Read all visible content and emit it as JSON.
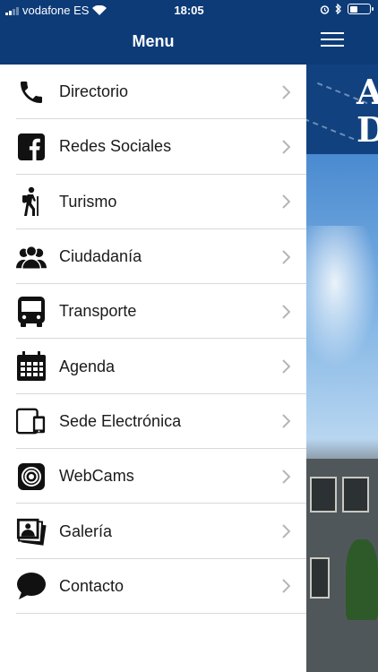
{
  "status_bar": {
    "carrier": "vodafone ES",
    "time": "18:05"
  },
  "menu": {
    "title": "Menu",
    "items": [
      {
        "label": "Directorio",
        "icon": "phone-icon"
      },
      {
        "label": "Redes Sociales",
        "icon": "facebook-icon"
      },
      {
        "label": "Turismo",
        "icon": "hiker-icon"
      },
      {
        "label": "Ciudadanía",
        "icon": "people-icon"
      },
      {
        "label": "Transporte",
        "icon": "bus-icon"
      },
      {
        "label": "Agenda",
        "icon": "calendar-icon"
      },
      {
        "label": "Sede Electrónica",
        "icon": "devices-icon"
      },
      {
        "label": "WebCams",
        "icon": "webcam-icon"
      },
      {
        "label": "Galería",
        "icon": "gallery-icon"
      },
      {
        "label": "Contacto",
        "icon": "chat-bubble-icon"
      }
    ]
  },
  "background_app": {
    "banner_letters": [
      "A",
      "D"
    ]
  },
  "colors": {
    "header": "#0c3b78",
    "text": "#1a1a1a",
    "divider": "#d8d8d8",
    "chevron": "#b5b5b5"
  }
}
